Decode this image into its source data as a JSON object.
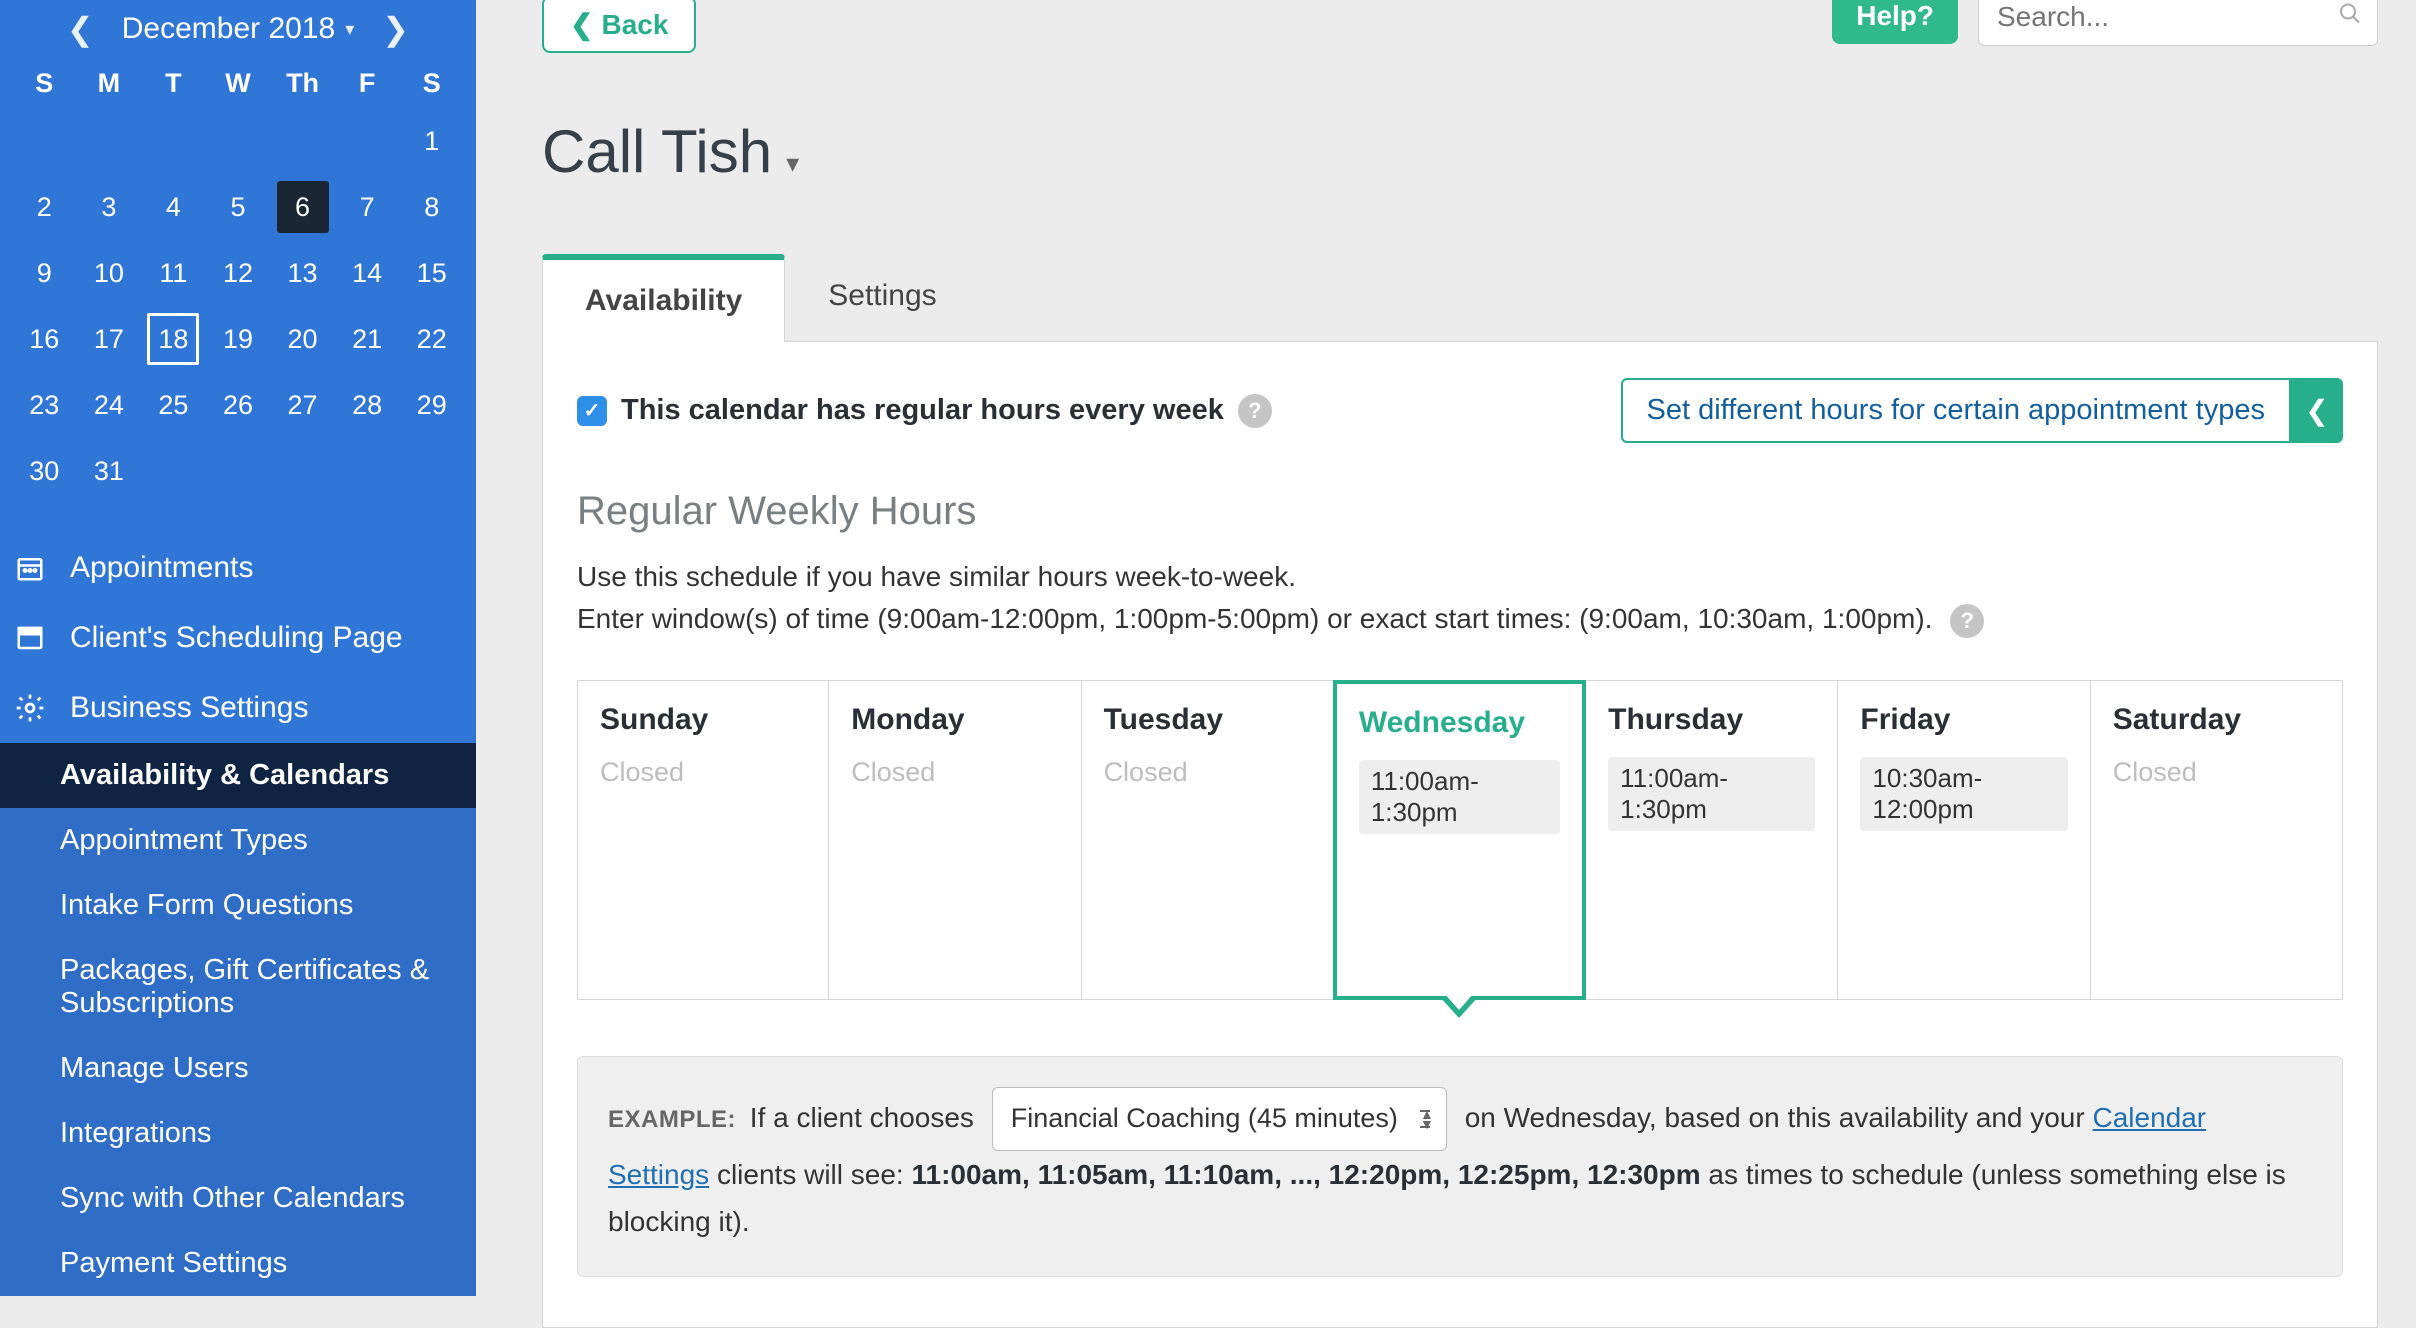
{
  "sidebar": {
    "calendar": {
      "title": "December 2018",
      "days_of_week": [
        "S",
        "M",
        "T",
        "W",
        "Th",
        "F",
        "S"
      ],
      "leading_blanks": 6,
      "days": 31,
      "selected_day": 6,
      "today_outline_day": 18
    },
    "nav": {
      "appointments": "Appointments",
      "client_page": "Client's Scheduling Page",
      "business_settings": "Business Settings"
    },
    "subnav": [
      "Availability & Calendars",
      "Appointment Types",
      "Intake Form Questions",
      "Packages, Gift Certificates & Subscriptions",
      "Manage Users",
      "Integrations",
      "Sync with Other Calendars",
      "Payment Settings"
    ],
    "active_sub_index": 0
  },
  "topbar": {
    "back": "Back",
    "help": "Help?",
    "search_placeholder": "Search..."
  },
  "page_title": "Call Tish",
  "tabs": {
    "availability": "Availability",
    "settings": "Settings",
    "active": "availability"
  },
  "regular_hours": {
    "checkbox_label": "This calendar has regular hours every week",
    "diff_hours_btn": "Set different hours for certain appointment types",
    "heading": "Regular Weekly Hours",
    "desc_line1": "Use this schedule if you have similar hours week-to-week.",
    "desc_line2": "Enter window(s) of time (9:00am-12:00pm, 1:00pm-5:00pm) or exact start times: (9:00am, 10:30am, 1:00pm).",
    "days": [
      {
        "name": "Sunday",
        "status": "closed",
        "value": "Closed"
      },
      {
        "name": "Monday",
        "status": "closed",
        "value": "Closed"
      },
      {
        "name": "Tuesday",
        "status": "closed",
        "value": "Closed"
      },
      {
        "name": "Wednesday",
        "status": "open",
        "value": "11:00am-1:30pm",
        "selected": true
      },
      {
        "name": "Thursday",
        "status": "open",
        "value": "11:00am-1:30pm"
      },
      {
        "name": "Friday",
        "status": "open",
        "value": "10:30am-12:00pm"
      },
      {
        "name": "Saturday",
        "status": "closed",
        "value": "Closed"
      }
    ]
  },
  "example": {
    "label": "EXAMPLE:",
    "text_before_select": "If a client chooses",
    "select_value": "Financial Coaching (45 minutes)",
    "text_after_select_1": "on Wednesday, based on this availability and your ",
    "calendar_settings_link": "Calendar Settings",
    "text_after_link": " clients will see:  ",
    "bold_times": "11:00am, 11:05am, 11:10am, ..., 12:20pm, 12:25pm, 12:30pm",
    "text_tail": " as times to schedule (unless something else is blocking it)."
  }
}
